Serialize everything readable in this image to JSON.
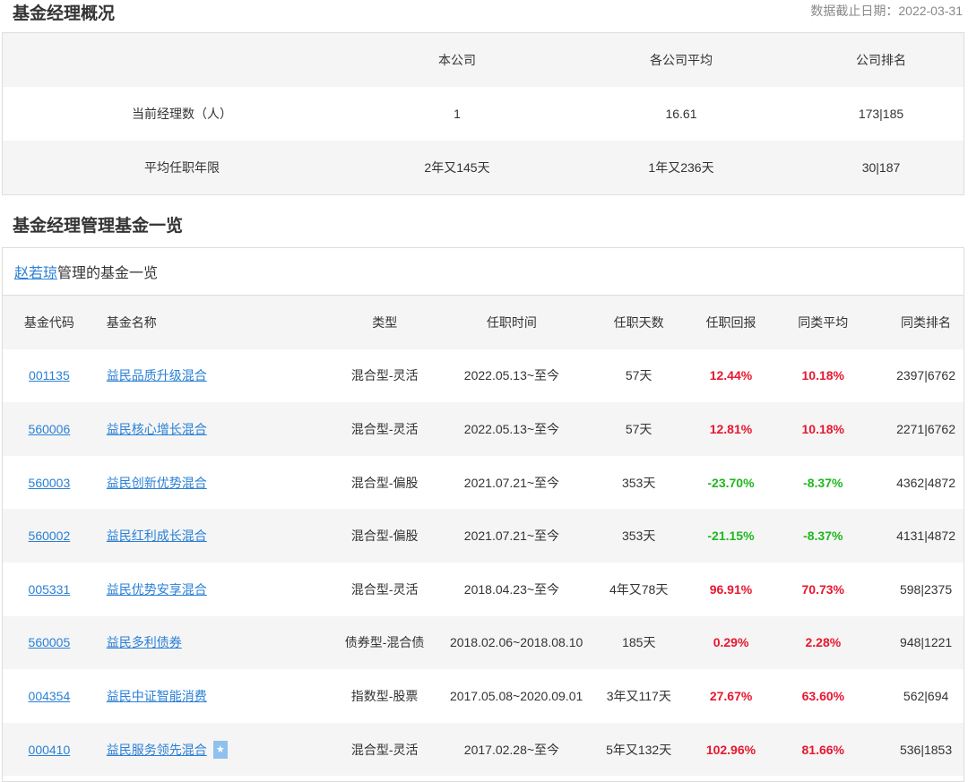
{
  "overview": {
    "title": "基金经理概况",
    "date_label": "数据截止日期：2022-03-31",
    "headers": [
      "",
      "本公司",
      "各公司平均",
      "公司排名"
    ],
    "rows": [
      [
        "当前经理数（人）",
        "1",
        "16.61",
        "173|185"
      ],
      [
        "平均任职年限",
        "2年又145天",
        "1年又236天",
        "30|187"
      ]
    ]
  },
  "funds": {
    "title": "基金经理管理基金一览",
    "manager": "赵若琼",
    "caption_suffix": "管理的基金一览",
    "headers": [
      "基金代码",
      "基金名称",
      "类型",
      "任职时间",
      "任职天数",
      "任职回报",
      "同类平均",
      "同类排名"
    ],
    "rows": [
      [
        "001135",
        "益民品质升级混合",
        "混合型-灵活",
        "2022.05.13~至今",
        "57天",
        "12.44%",
        "10.18%",
        "2397|6762"
      ],
      [
        "560006",
        "益民核心增长混合",
        "混合型-灵活",
        "2022.05.13~至今",
        "57天",
        "12.81%",
        "10.18%",
        "2271|6762"
      ],
      [
        "560003",
        "益民创新优势混合",
        "混合型-偏股",
        "2021.07.21~至今",
        "353天",
        "-23.70%",
        "-8.37%",
        "4362|4872"
      ],
      [
        "560002",
        "益民红利成长混合",
        "混合型-偏股",
        "2021.07.21~至今",
        "353天",
        "-21.15%",
        "-8.37%",
        "4131|4872"
      ],
      [
        "005331",
        "益民优势安享混合",
        "混合型-灵活",
        "2018.04.23~至今",
        "4年又78天",
        "96.91%",
        "70.73%",
        "598|2375"
      ],
      [
        "560005",
        "益民多利债券",
        "债券型-混合债",
        "2018.02.06~2018.08.10",
        "185天",
        "0.29%",
        "2.28%",
        "948|1221"
      ],
      [
        "004354",
        "益民中证智能消费",
        "指数型-股票",
        "2017.05.08~2020.09.01",
        "3年又117天",
        "27.67%",
        "63.60%",
        "562|694"
      ],
      [
        "000410",
        "益民服务领先混合",
        "混合型-灵活",
        "2017.02.28~至今",
        "5年又132天",
        "102.96%",
        "81.66%",
        "536|1853"
      ]
    ],
    "starred_index": 7
  },
  "colors": {
    "positive": "#e8172f",
    "negative": "#1fb81f",
    "link": "#2a80d6"
  }
}
